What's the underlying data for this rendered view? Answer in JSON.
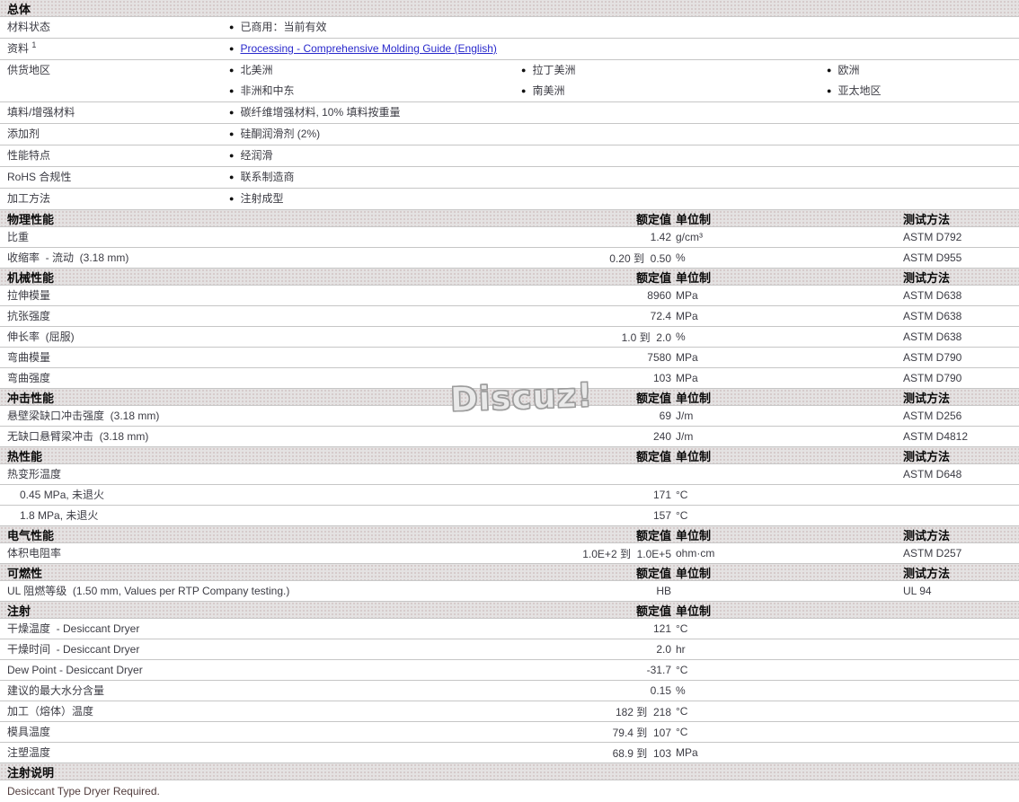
{
  "page": {
    "watermark": "Discuz!"
  },
  "columns": {
    "rated": "额定值",
    "unit": "单位制",
    "test": "测试方法"
  },
  "colors": {
    "link": "#2929cc",
    "note_text": "#523d3d",
    "bar_bg": "#e4e2e2",
    "body_text": "#3c3c44"
  },
  "sections": [
    {
      "type": "bullets",
      "title": "总体",
      "rows": [
        {
          "label": "材料状态",
          "cols": [
            [
              {
                "text": "已商用：当前有效"
              }
            ]
          ]
        },
        {
          "label": "资料",
          "sup": "1",
          "cols": [
            [
              {
                "text": "Processing - Comprehensive Molding Guide (English)",
                "link": true
              }
            ]
          ]
        },
        {
          "label": "供货地区",
          "cols": [
            [
              {
                "text": "北美洲"
              },
              {
                "text": "非洲和中东"
              }
            ],
            [
              {
                "text": "拉丁美洲"
              },
              {
                "text": "南美洲"
              }
            ],
            [
              {
                "text": "欧洲"
              },
              {
                "text": "亚太地区"
              }
            ]
          ]
        },
        {
          "label": "填料/增强材料",
          "cols": [
            [
              {
                "text": "碳纤维增强材料, 10% 填料按重量"
              }
            ]
          ]
        },
        {
          "label": "添加剂",
          "cols": [
            [
              {
                "text": "硅酮润滑剂 (2%)"
              }
            ]
          ]
        },
        {
          "label": "性能特点",
          "cols": [
            [
              {
                "text": "经润滑"
              }
            ]
          ]
        },
        {
          "label": "RoHS 合规性",
          "cols": [
            [
              {
                "text": "联系制造商"
              }
            ]
          ]
        },
        {
          "label": "加工方法",
          "cols": [
            [
              {
                "text": "注射成型"
              }
            ]
          ]
        }
      ]
    },
    {
      "type": "props",
      "title": "物理性能",
      "show_test": true,
      "rows": [
        {
          "label": "比重",
          "value": "1.42",
          "unit": "g/cm³",
          "test": "ASTM D792"
        },
        {
          "label": "收缩率  - 流动  (3.18 mm)",
          "value": "0.20 到  0.50",
          "unit": "%",
          "test": "ASTM D955"
        }
      ]
    },
    {
      "type": "props",
      "title": "机械性能",
      "show_test": true,
      "rows": [
        {
          "label": "拉伸模量",
          "value": "8960",
          "unit": "MPa",
          "test": "ASTM D638"
        },
        {
          "label": "抗张强度",
          "value": "72.4",
          "unit": "MPa",
          "test": "ASTM D638"
        },
        {
          "label": "伸长率  (屈服)",
          "value": "1.0 到  2.0",
          "unit": "%",
          "test": "ASTM D638"
        },
        {
          "label": "弯曲模量",
          "value": "7580",
          "unit": "MPa",
          "test": "ASTM D790"
        },
        {
          "label": "弯曲强度",
          "value": "103",
          "unit": "MPa",
          "test": "ASTM D790"
        }
      ]
    },
    {
      "type": "props",
      "title": "冲击性能",
      "show_test": true,
      "rows": [
        {
          "label": "悬壁梁缺口冲击强度  (3.18 mm)",
          "value": "69",
          "unit": "J/m",
          "test": "ASTM D256"
        },
        {
          "label": "无缺口悬臂梁冲击  (3.18 mm)",
          "value": "240",
          "unit": "J/m",
          "test": "ASTM D4812"
        }
      ]
    },
    {
      "type": "props",
      "title": "热性能",
      "show_test": true,
      "rows": [
        {
          "label": "热变形温度",
          "value": "",
          "unit": "",
          "test": "ASTM D648"
        },
        {
          "label": "0.45 MPa, 未退火",
          "indent": true,
          "value": "171",
          "unit": "°C",
          "test": ""
        },
        {
          "label": "1.8 MPa, 未退火",
          "indent": true,
          "value": "157",
          "unit": "°C",
          "test": ""
        }
      ]
    },
    {
      "type": "props",
      "title": "电气性能",
      "show_test": true,
      "rows": [
        {
          "label": "体积电阻率",
          "value": "1.0E+2 到  1.0E+5",
          "unit": "ohm·cm",
          "test": "ASTM D257"
        }
      ]
    },
    {
      "type": "props",
      "title": "可燃性",
      "show_test": true,
      "rows": [
        {
          "label": "UL 阻燃等级  (1.50 mm, Values per RTP Company testing.)",
          "value": "HB",
          "unit": "",
          "test": "UL 94"
        }
      ]
    },
    {
      "type": "props",
      "title": "注射",
      "show_test": false,
      "rows": [
        {
          "label": "干燥温度  - Desiccant Dryer",
          "value": "121",
          "unit": "°C"
        },
        {
          "label": "干燥时间  - Desiccant Dryer",
          "value": "2.0",
          "unit": "hr"
        },
        {
          "label": "Dew Point - Desiccant Dryer",
          "value": "-31.7",
          "unit": "°C"
        },
        {
          "label": "建议的最大水分含量",
          "value": "0.15",
          "unit": "%"
        },
        {
          "label": "加工（熔体）温度",
          "value": "182 到  218",
          "unit": "°C"
        },
        {
          "label": "模具温度",
          "value": "79.4 到  107",
          "unit": "°C"
        },
        {
          "label": "注塑温度",
          "value": "68.9 到  103",
          "unit": "MPa"
        }
      ]
    },
    {
      "type": "note",
      "title": "注射说明",
      "note": "Desiccant Type Dryer Required."
    }
  ]
}
